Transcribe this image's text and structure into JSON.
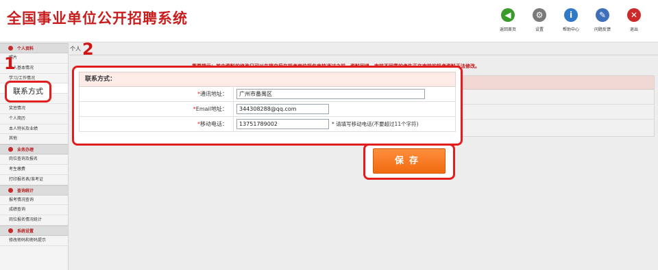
{
  "app_title": "全国事业单位公开招聘系统",
  "toolbar": [
    {
      "label": "返回首页",
      "icon": "home-arrow-icon",
      "color": "#3a9a2a",
      "glyph": "◀"
    },
    {
      "label": "设置",
      "icon": "gear-icon",
      "color": "#7a7a7a",
      "glyph": "⚙"
    },
    {
      "label": "帮助中心",
      "icon": "help-icon",
      "color": "#2f79c7",
      "glyph": "i"
    },
    {
      "label": "问题反馈",
      "icon": "feedback-icon",
      "color": "#3e6fb8",
      "glyph": "✎"
    },
    {
      "label": "退出",
      "icon": "exit-icon",
      "color": "#cc2a2a",
      "glyph": "✕"
    }
  ],
  "sidebar": {
    "sections": [
      {
        "title": "个人资料",
        "icon": "user-icon",
        "items": [
          "照片",
          "个人基本情况",
          "学习/工作情况",
          "联系方式",
          "家庭情况",
          "奖惩情况",
          "个人简历",
          "本人特长及业绩",
          "其他"
        ]
      },
      {
        "title": "业务办理",
        "icon": "business-icon",
        "items": [
          "岗位查询及报名",
          "考生缴费",
          "打印报名表/准考证"
        ]
      },
      {
        "title": "查询统计",
        "icon": "chart-icon",
        "items": [
          "报考情况查询",
          "成绩查询",
          "岗位报名情况统计"
        ]
      },
      {
        "title": "系统设置",
        "icon": "settings-icon",
        "items": [
          "修改密码和密码提示"
        ]
      }
    ]
  },
  "breadcrumb": "个人",
  "notice": "重要提示：其中资料的修改只可以在提交后在报考岗位报名审核通过之前，资料回退，审核不同意的考生正在审核的报考资料无法修改。",
  "form": {
    "title": "联系方式：",
    "fields": [
      {
        "label": "通讯地址：",
        "required_mark": "*",
        "value": "广州市番禺区",
        "hint": ""
      },
      {
        "label": "Email地址：",
        "required_mark": "*",
        "value": "344308288@qq.com",
        "hint": ""
      },
      {
        "label": "移动电话：",
        "required_mark": "*",
        "value": "13751789002",
        "hint": "* 请填写移动电话(不要超过11个字符)"
      }
    ],
    "save_label": "保存"
  },
  "annotations": {
    "step1": "1",
    "step2": "2",
    "callout": "联系方式"
  },
  "colors": {
    "brand_red": "#c81d1d",
    "highlight_red": "#e21d1d",
    "save_orange": "#f06a10"
  }
}
